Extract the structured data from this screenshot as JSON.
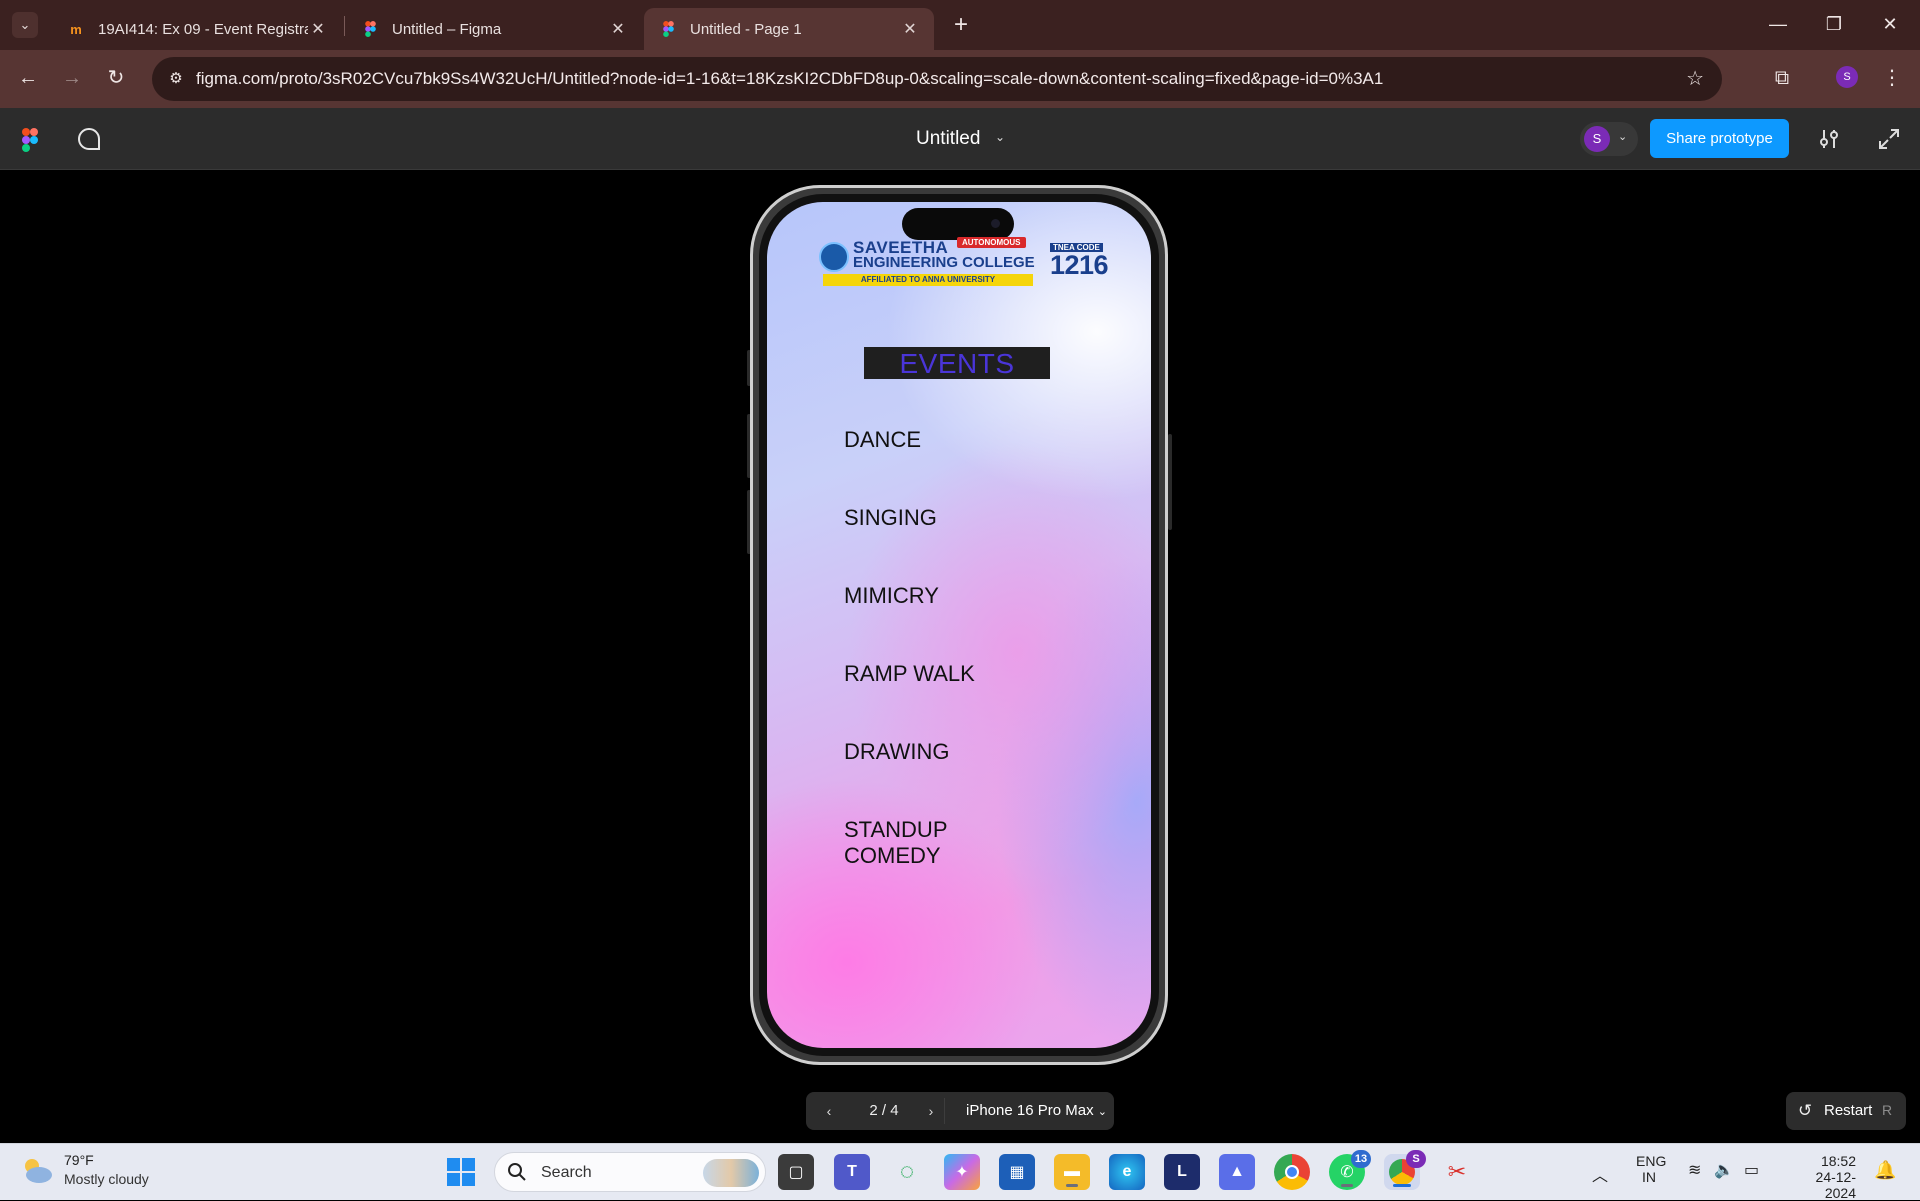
{
  "browser": {
    "tabs": [
      {
        "title": "19AI414: Ex 09 - Event Registrat",
        "favicon": "moodle-icon",
        "active": false
      },
      {
        "title": "Untitled – Figma",
        "favicon": "figma-icon",
        "active": false
      },
      {
        "title": "Untitled - Page 1",
        "favicon": "figma-icon",
        "active": true
      }
    ],
    "url": "figma.com/proto/3sR02CVcu7bk9Ss4W32UcH/Untitled?node-id=1-16&t=18KzsKI2CDbFD8up-0&scaling=scale-down&content-scaling=fixed&page-id=0%3A1",
    "profile_initial": "S"
  },
  "figma": {
    "file_title": "Untitled",
    "user_initial": "S",
    "share_label": "Share prototype",
    "accent_color": "#0d99ff"
  },
  "prototype": {
    "logo": {
      "line1": "SAVEETHA",
      "line2": "ENGINEERING COLLEGE",
      "badge": "AUTONOMOUS",
      "affiliation": "AFFILIATED TO ANNA UNIVERSITY",
      "code_label": "TNEA CODE",
      "code": "1216"
    },
    "heading": "EVENTS",
    "events": [
      "DANCE",
      "SINGING",
      "MIMICRY",
      "RAMP WALK",
      "DRAWING",
      "STANDUP",
      "COMEDY"
    ]
  },
  "controls": {
    "page_counter": "2 / 4",
    "device": "iPhone 16 Pro Max",
    "restart_label": "Restart",
    "restart_key": "R"
  },
  "taskbar": {
    "weather_temp": "79°F",
    "weather_desc": "Mostly cloudy",
    "search_label": "Search",
    "whatsapp_badge": "13",
    "lang_line1": "ENG",
    "lang_line2": "IN",
    "time": "18:52",
    "date": "24-12-2024"
  }
}
